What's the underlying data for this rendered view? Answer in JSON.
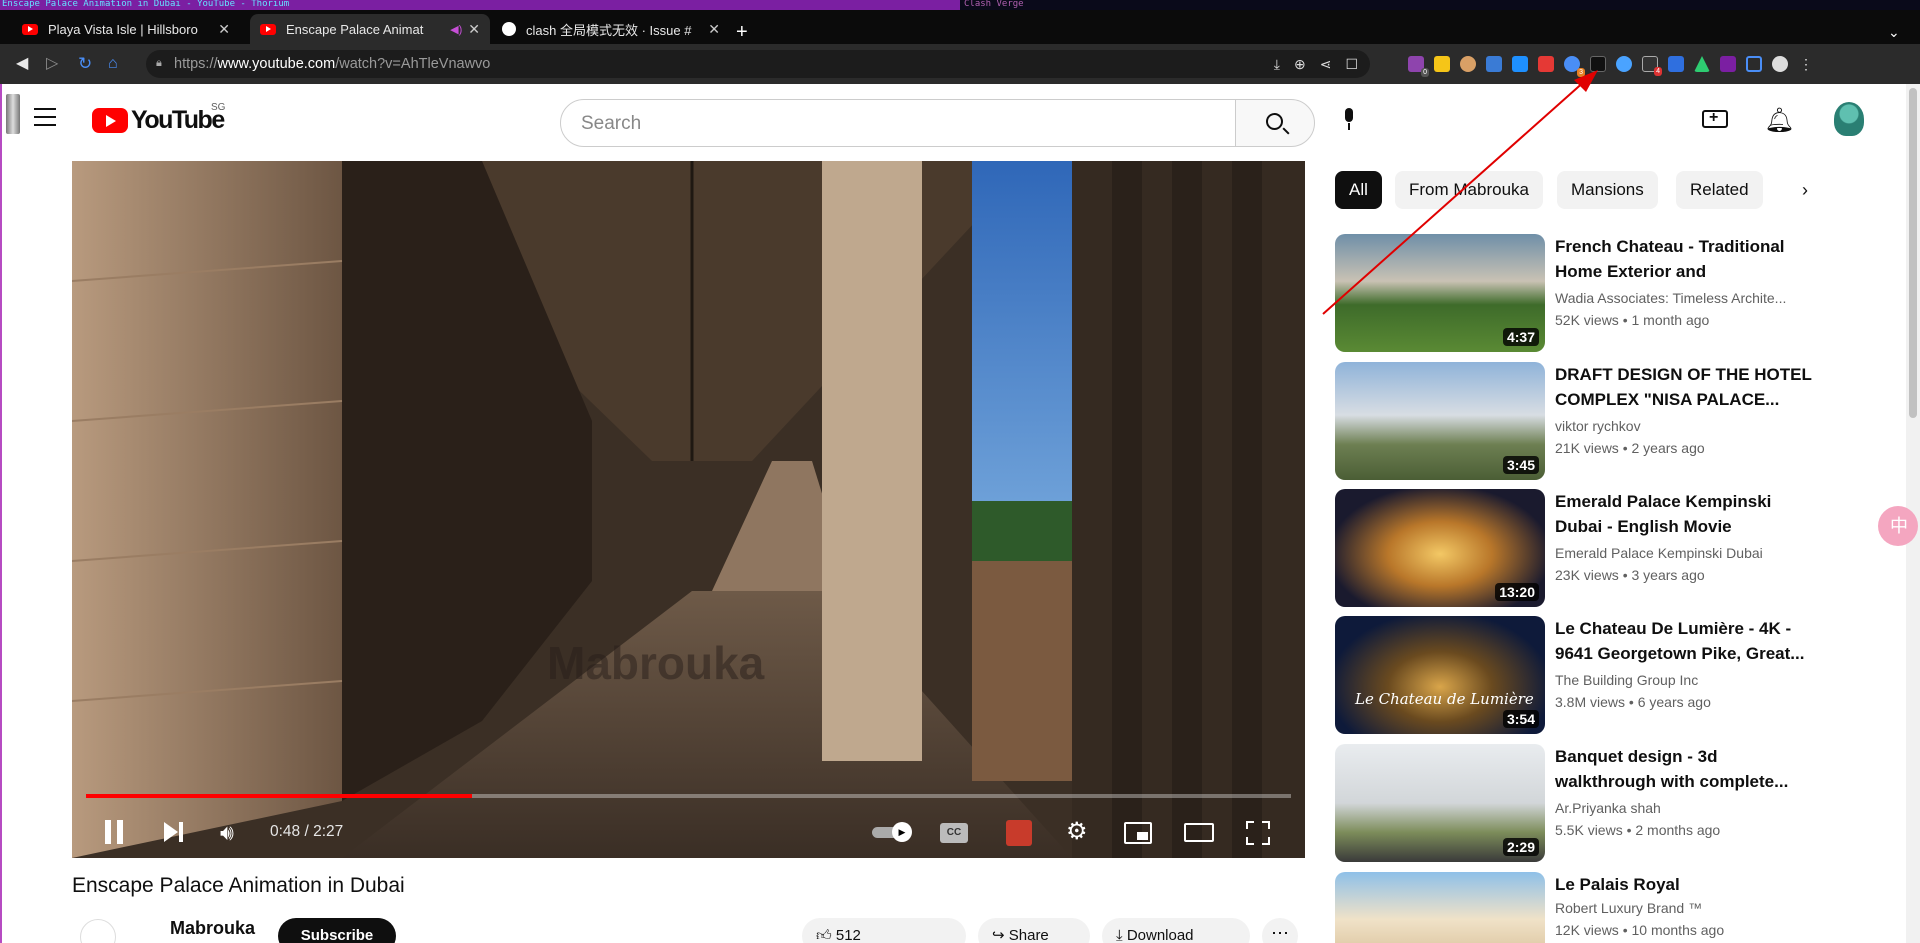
{
  "wm": {
    "left_title": "Enscape Palace Animation in Dubai - YouTube - Thorium",
    "right_title": "Clash Verge"
  },
  "tabs": [
    {
      "label": "Playa Vista Isle | Hillsboro",
      "icon": "youtube-icon"
    },
    {
      "label": "Enscape Palace Animat",
      "icon": "youtube-icon"
    },
    {
      "label": "clash 全局模式无效 · Issue #",
      "icon": "github-icon"
    }
  ],
  "browser": {
    "url_prefix": "https://",
    "url_host": "www.youtube.com",
    "url_path": "/watch?v=AhTleVnawvo",
    "extension_badges": {
      "ext_a": "0",
      "ext_b": "3",
      "ext_c": "4"
    }
  },
  "header": {
    "logo_text": "YouTube",
    "region": "SG",
    "search_placeholder": "Search"
  },
  "player": {
    "watermark": "Mabrouka",
    "time": "0:48 / 2:27",
    "progress": 0.32,
    "cc_label": "CC"
  },
  "video": {
    "title": "Enscape Palace Animation in Dubai",
    "channel": "Mabrouka",
    "subscribe_label": "Subscribe",
    "likes": "512",
    "share_label": "Share",
    "download_label": "Download"
  },
  "chips": [
    "All",
    "From Mabrouka",
    "Mansions",
    "Related"
  ],
  "recommendations": [
    {
      "title": "French Chateau - Traditional Home Exterior and Transitiona...",
      "channel": "Wadia Associates: Timeless Archite...",
      "meta": "52K views  • 1 month ago",
      "duration": "4:37"
    },
    {
      "title": "DRAFT DESIGN OF THE HOTEL COMPLEX \"NISA PALACE...",
      "channel": "viktor rychkov",
      "meta": "21K views  • 2 years ago",
      "duration": "3:45"
    },
    {
      "title": "Emerald Palace Kempinski Dubai - English Movie",
      "channel": "Emerald Palace Kempinski Dubai",
      "meta": "23K views  • 3 years ago",
      "duration": "13:20"
    },
    {
      "title": "Le Chateau De Lumière - 4K - 9641 Georgetown Pike, Great...",
      "channel": "The Building Group Inc",
      "meta": "3.8M views  • 6 years ago",
      "duration": "3:54"
    },
    {
      "title": "Banquet design - 3d walkthrough with complete...",
      "channel": "Ar.Priyanka shah",
      "meta": "5.5K views  • 2 months ago",
      "duration": "2:29"
    },
    {
      "title": "Le Palais Royal",
      "channel": "Robert Luxury Brand ™",
      "meta": "12K views  • 10 months ago",
      "duration": ""
    }
  ],
  "thumb_text": {
    "rec4": "Le Chateau de Lumière"
  },
  "colors": {
    "accent": "#ff0000",
    "annotation_arrow": "#e00000"
  }
}
